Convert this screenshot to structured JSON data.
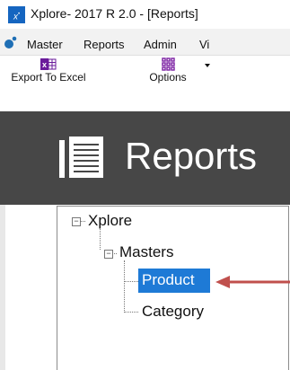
{
  "window": {
    "title": "Xplore- 2017 R 2.0  - [Reports]"
  },
  "menu": [
    {
      "label": "Master"
    },
    {
      "label": "Reports"
    },
    {
      "label": "Admin"
    },
    {
      "label": "Vi"
    }
  ],
  "toolbar": {
    "export_label": "Export To Excel",
    "options_label": "Options"
  },
  "header": {
    "title": "Reports"
  },
  "tree": {
    "root": "Xplore",
    "group": "Masters",
    "items": [
      "Product",
      "Category"
    ],
    "selected": "Product"
  },
  "colors": {
    "header_bg": "#474747",
    "selection": "#1e7ad6",
    "arrow": "#c0504d",
    "excel_icon": "#6a1b9a",
    "app_icon": "#1565c0"
  },
  "icons": {
    "app": "xplore-app-icon",
    "excel": "excel-icon",
    "options": "grid-icon",
    "reports": "document-lines-icon"
  }
}
